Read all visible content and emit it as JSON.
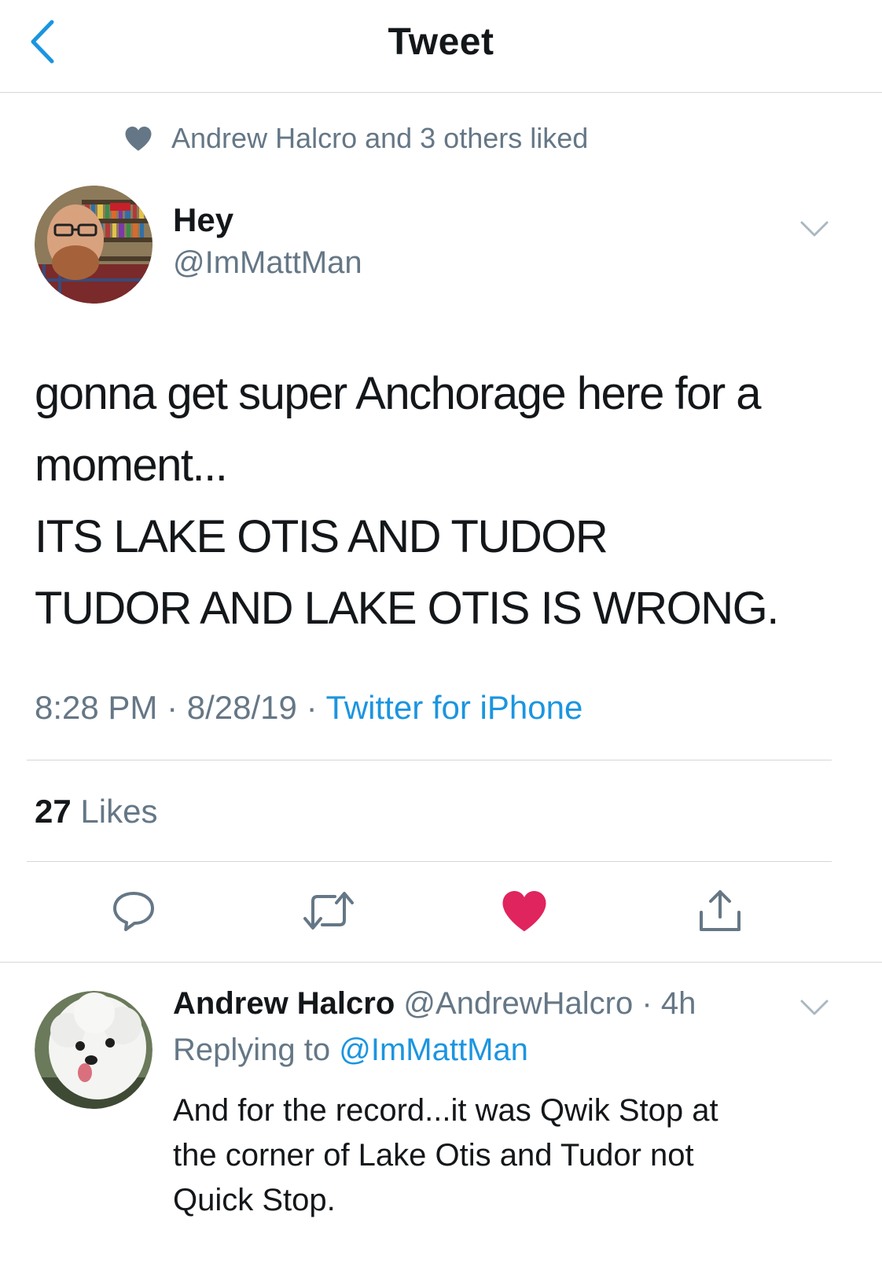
{
  "header": {
    "title": "Tweet",
    "back_icon": "chevron-left-icon",
    "accent_color": "#1b95e0"
  },
  "social_context": {
    "icon": "heart-icon",
    "text": "Andrew Halcro and 3 others liked"
  },
  "tweet": {
    "author": {
      "name": "Hey",
      "handle": "@ImMattMan",
      "avatar": "avatar-photo"
    },
    "text_lines": [
      "gonna get super Anchorage here for a",
      "moment...",
      "ITS LAKE OTIS AND TUDOR",
      "TUDOR AND LAKE OTIS IS WRONG."
    ],
    "time": "8:28 PM",
    "date": "8/28/19",
    "separator": "·",
    "source": "Twitter for iPhone",
    "likes_count": "27",
    "likes_label": "Likes",
    "actions": {
      "reply_icon": "reply-icon",
      "retweet_icon": "retweet-icon",
      "like_icon": "heart-filled-icon",
      "like_color": "#e0245e",
      "share_icon": "share-icon"
    }
  },
  "reply": {
    "author_name": "Andrew Halcro",
    "handle": "@AndrewHalcro",
    "separator": "·",
    "time": "4h",
    "replying_prefix": "Replying to",
    "replying_handle": "@ImMattMan",
    "text_lines": [
      "And for the record...it was Qwik Stop at",
      "the corner of Lake Otis and Tudor not",
      "Quick Stop."
    ]
  }
}
